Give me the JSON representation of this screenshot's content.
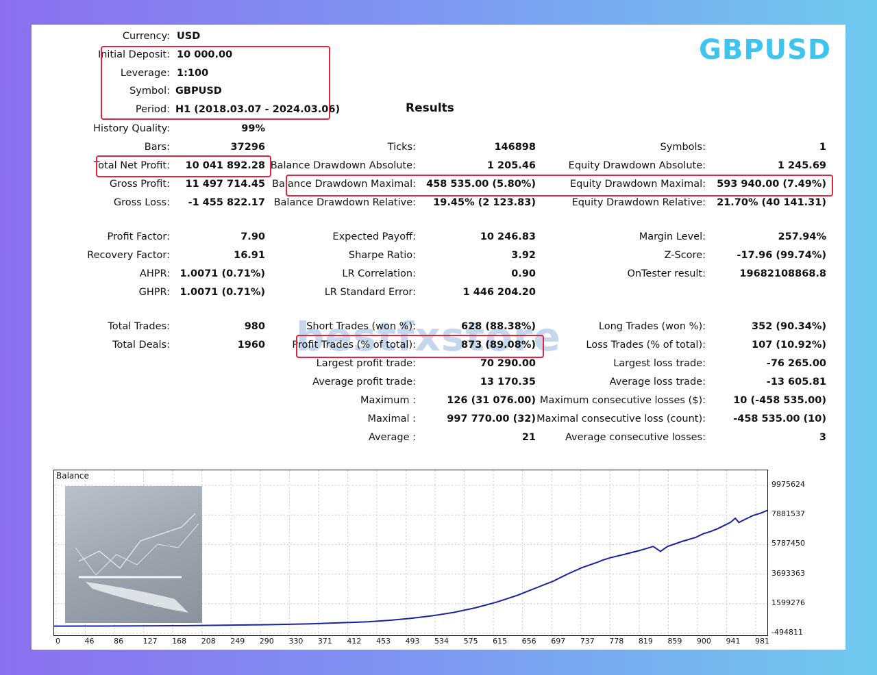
{
  "symbol_title": "GBPUSD",
  "results_title": "Results",
  "settings": [
    {
      "label": "Currency:",
      "value": "USD"
    },
    {
      "label": "Initial Deposit:",
      "value": "10 000.00"
    },
    {
      "label": "Leverage:",
      "value": "1:100"
    },
    {
      "label": "Symbol:",
      "value": "GBPUSD"
    },
    {
      "label": "Period:",
      "value": "H1 (2018.03.07 - 2024.03.06)"
    }
  ],
  "col1": [
    {
      "label": "History Quality:",
      "value": "99%"
    },
    {
      "label": "Bars:",
      "value": "37296"
    },
    {
      "label": "Total Net Profit:",
      "value": "10 041 892.28"
    },
    {
      "label": "Gross Profit:",
      "value": "11 497 714.45"
    },
    {
      "label": "Gross Loss:",
      "value": "-1 455 822.17"
    },
    {
      "label": "Profit Factor:",
      "value": "7.90"
    },
    {
      "label": "Recovery Factor:",
      "value": "16.91"
    },
    {
      "label": "AHPR:",
      "value": "1.0071 (0.71%)"
    },
    {
      "label": "GHPR:",
      "value": "1.0071 (0.71%)"
    },
    {
      "label": "Total Trades:",
      "value": "980"
    },
    {
      "label": "Total Deals:",
      "value": "1960"
    }
  ],
  "col2": [
    {
      "label": "Ticks:",
      "value": "146898"
    },
    {
      "label": "Balance Drawdown Absolute:",
      "value": "1 205.46"
    },
    {
      "label": "Balance Drawdown Maximal:",
      "value": "458 535.00 (5.80%)"
    },
    {
      "label": "Balance Drawdown Relative:",
      "value": "19.45% (2 123.83)"
    },
    {
      "label": "Expected Payoff:",
      "value": "10 246.83"
    },
    {
      "label": "Sharpe Ratio:",
      "value": "3.92"
    },
    {
      "label": "LR Correlation:",
      "value": "0.90"
    },
    {
      "label": "LR Standard Error:",
      "value": "1 446 204.20"
    },
    {
      "label": "Short Trades (won %):",
      "value": "628 (88.38%)"
    },
    {
      "label": "Profit Trades (% of total):",
      "value": "873 (89.08%)"
    },
    {
      "label": "Largest profit trade:",
      "value": "70 290.00"
    },
    {
      "label": "Average profit trade:",
      "value": "13 170.35"
    },
    {
      "label": "Maximum :",
      "value": "126 (31 076.00)"
    },
    {
      "label": "Maximal :",
      "value": "997 770.00 (32)"
    },
    {
      "label": "Average :",
      "value": "21"
    }
  ],
  "col3": [
    {
      "label": "Symbols:",
      "value": "1"
    },
    {
      "label": "Equity Drawdown Absolute:",
      "value": "1 245.69"
    },
    {
      "label": "Equity Drawdown Maximal:",
      "value": "593 940.00 (7.49%)"
    },
    {
      "label": "Equity Drawdown Relative:",
      "value": "21.70% (40 141.31)"
    },
    {
      "label": "Margin Level:",
      "value": "257.94%"
    },
    {
      "label": "Z-Score:",
      "value": "-17.96 (99.74%)"
    },
    {
      "label": "OnTester result:",
      "value": "19682108868.8"
    },
    {
      "label": "Long Trades (won %):",
      "value": "352 (90.34%)"
    },
    {
      "label": "Loss Trades (% of total):",
      "value": "107 (10.92%)"
    },
    {
      "label": "Largest loss trade:",
      "value": "-76 265.00"
    },
    {
      "label": "Average loss trade:",
      "value": "-13 605.81"
    },
    {
      "label": "Maximum consecutive losses ($):",
      "value": "10 (-458 535.00)"
    },
    {
      "label": "Maximal consecutive loss (count):",
      "value": "-458 535.00 (10)"
    },
    {
      "label": "Average consecutive losses:",
      "value": "3"
    }
  ],
  "watermark": {
    "part1": "bestfx",
    "part2": "store"
  },
  "colors": {
    "highlight": "#e0243e",
    "title": "#3ec5ef",
    "balance_line": "#1b1fa3"
  },
  "chart_data": {
    "type": "line",
    "title": "Balance",
    "x_ticks": [
      "0",
      "46",
      "86",
      "127",
      "168",
      "208",
      "249",
      "290",
      "330",
      "371",
      "412",
      "453",
      "493",
      "534",
      "575",
      "615",
      "656",
      "697",
      "737",
      "778",
      "819",
      "859",
      "900",
      "941",
      "981"
    ],
    "y_ticks": [
      "9975624",
      "7881537",
      "5787450",
      "3693363",
      "1599276",
      "-494811"
    ],
    "ylim": [
      -494811,
      9975624
    ],
    "xlim": [
      0,
      1000
    ],
    "series": [
      {
        "x": [
          0,
          60,
          120,
          180,
          240,
          300,
          360,
          400,
          440,
          470,
          500,
          530,
          560,
          590,
          620,
          650,
          680,
          700,
          720,
          740,
          760,
          770,
          780,
          800,
          820,
          840,
          850,
          860,
          880,
          900,
          910,
          920,
          930,
          940,
          948,
          955,
          960,
          970,
          980,
          990,
          1000
        ],
        "y": [
          10000,
          15000,
          25000,
          40000,
          70000,
          110000,
          170000,
          240000,
          320000,
          420000,
          560000,
          740000,
          980000,
          1300000,
          1700000,
          2200000,
          2800000,
          3200000,
          3700000,
          4150000,
          4500000,
          4700000,
          4850000,
          5100000,
          5350000,
          5650000,
          5300000,
          5650000,
          6000000,
          6300000,
          6550000,
          6700000,
          6900000,
          7150000,
          7350000,
          7650000,
          7350000,
          7600000,
          7850000,
          8000000,
          8200000
        ]
      }
    ]
  }
}
